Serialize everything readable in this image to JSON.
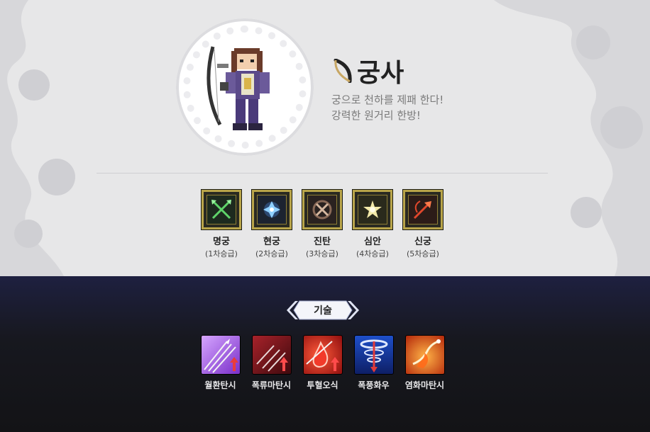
{
  "job": {
    "name": "궁사",
    "icon": "bow-icon",
    "description_lines": [
      "궁으로 천하를 제패 한다!",
      "강력한 원거리 한방!"
    ]
  },
  "advancements": [
    {
      "name": "명궁",
      "tier": "(1차승급)",
      "icon": "crossed-arrows-icon",
      "color": "#5fd46a"
    },
    {
      "name": "현궁",
      "tier": "(2차승급)",
      "icon": "frost-arrow-icon",
      "color": "#8fd0ff"
    },
    {
      "name": "진탄",
      "tier": "(3차승급)",
      "icon": "x-seal-icon",
      "color": "#d6b8a0"
    },
    {
      "name": "심안",
      "tier": "(4차승급)",
      "icon": "radiant-eye-icon",
      "color": "#f2e9a8"
    },
    {
      "name": "신궁",
      "tier": "(5차승급)",
      "icon": "fire-arrow-icon",
      "color": "#e0472c"
    }
  ],
  "skills_section": {
    "title": "기술",
    "skills": [
      {
        "name": "월환탄시",
        "icon": "moon-arrows-icon",
        "color": "#a35be0"
      },
      {
        "name": "폭류마탄시",
        "icon": "torrent-arrows-icon",
        "color": "#8a1a1a"
      },
      {
        "name": "투혈오식",
        "icon": "blood-drop-icon",
        "color": "#d8251e"
      },
      {
        "name": "폭풍화우",
        "icon": "storm-arrow-icon",
        "color": "#2e5fd6"
      },
      {
        "name": "염화마탄시",
        "icon": "flame-arrow-icon",
        "color": "#e85a12"
      }
    ]
  },
  "colors": {
    "top_background": "#e7e7e8",
    "bottom_background": "#17181f",
    "frame_gold": "#b9a54a"
  }
}
